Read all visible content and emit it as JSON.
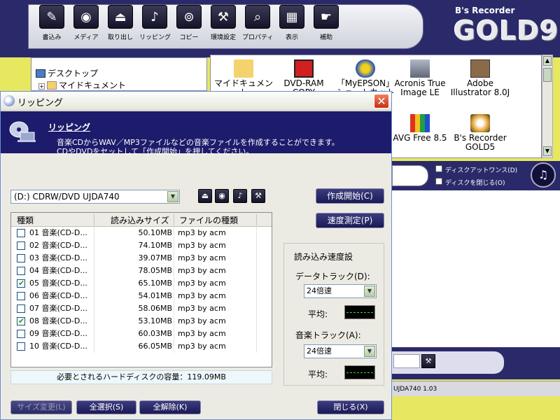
{
  "toolbar": {
    "items": [
      {
        "label": "書込み",
        "icon": "pencil-icon"
      },
      {
        "label": "メディア",
        "icon": "disc-icon"
      },
      {
        "label": "取り出し",
        "icon": "eject-icon"
      },
      {
        "label": "リッピング",
        "icon": "rip-icon"
      },
      {
        "label": "コピー",
        "icon": "copy-discs-icon"
      },
      {
        "label": "環境設定",
        "icon": "tools-icon"
      },
      {
        "label": "プロパティ",
        "icon": "properties-icon"
      },
      {
        "label": "表示",
        "icon": "display-icon"
      },
      {
        "label": "補助",
        "icon": "hand-icon"
      }
    ]
  },
  "logo": {
    "small": "B's Recorder",
    "big": "GOLD9"
  },
  "tree": {
    "items": [
      "デスクトップ",
      "マイドキュメント"
    ]
  },
  "files": {
    "items": [
      {
        "label": "マイドキュメン",
        "label2": "ト"
      },
      {
        "label": "DVD-RAM",
        "label2": "COPY"
      },
      {
        "label": "「MyEPSON」",
        "label2": "ショートカット"
      },
      {
        "label": "Acronis True",
        "label2": "Image LE"
      },
      {
        "label": "Adobe",
        "label2": "Illustrator 8.0J"
      },
      {
        "label": "AVG Free 8.5",
        "label2": ""
      },
      {
        "label": "B's Recorder",
        "label2": "GOLD5"
      }
    ]
  },
  "options": {
    "disc_at_once": "ディスクアットワンス(D)",
    "close_disc": "ディスクを閉じる(O)"
  },
  "status": {
    "text": "UJDA740 1.03"
  },
  "dialog": {
    "title": "リッピング",
    "header_title": "リッピング",
    "header_line1": "音楽CDからWAV／MP3ファイルなどの音楽ファイルを作成することができます。",
    "header_line2": "CDやDVDをセットして「作成開始」を押してください。",
    "drive": "(D:) CDRW/DVD UJDA740",
    "buttons": {
      "start": "作成開始(C)",
      "speed_test": "速度測定(P)",
      "size_change": "サイズ変更(L)",
      "select_all": "全選択(S)",
      "deselect_all": "全解除(K)",
      "close": "閉じる(X)"
    },
    "columns": {
      "type": "種類",
      "size": "読み込みサイズ",
      "filetype": "ファイルの種類"
    },
    "tracks": [
      {
        "name": "01 音楽(CD-D...",
        "size": "50.10MB",
        "type": "mp3 by acm",
        "checked": false
      },
      {
        "name": "02 音楽(CD-D...",
        "size": "74.10MB",
        "type": "mp3 by acm",
        "checked": false
      },
      {
        "name": "03 音楽(CD-D...",
        "size": "39.07MB",
        "type": "mp3 by acm",
        "checked": false
      },
      {
        "name": "04 音楽(CD-D...",
        "size": "78.05MB",
        "type": "mp3 by acm",
        "checked": false
      },
      {
        "name": "05 音楽(CD-D...",
        "size": "65.10MB",
        "type": "mp3 by acm",
        "checked": true
      },
      {
        "name": "06 音楽(CD-D...",
        "size": "54.01MB",
        "type": "mp3 by acm",
        "checked": false
      },
      {
        "name": "07 音楽(CD-D...",
        "size": "58.06MB",
        "type": "mp3 by acm",
        "checked": false
      },
      {
        "name": "08 音楽(CD-D...",
        "size": "53.10MB",
        "type": "mp3 by acm",
        "checked": true
      },
      {
        "name": "09 音楽(CD-D...",
        "size": "60.03MB",
        "type": "mp3 by acm",
        "checked": false
      },
      {
        "name": "10 音楽(CD-D...",
        "size": "66.05MB",
        "type": "mp3 by acm",
        "checked": false
      }
    ],
    "required_space": "必要とされるハードディスクの容量：119.09MB",
    "speed_group": {
      "title": "読み込み速度設",
      "data_track_label": "データトラック(D):",
      "data_track_speed": "24倍速",
      "music_track_label": "音楽トラック(A):",
      "music_track_speed": "24倍速",
      "average_label": "平均:"
    }
  }
}
